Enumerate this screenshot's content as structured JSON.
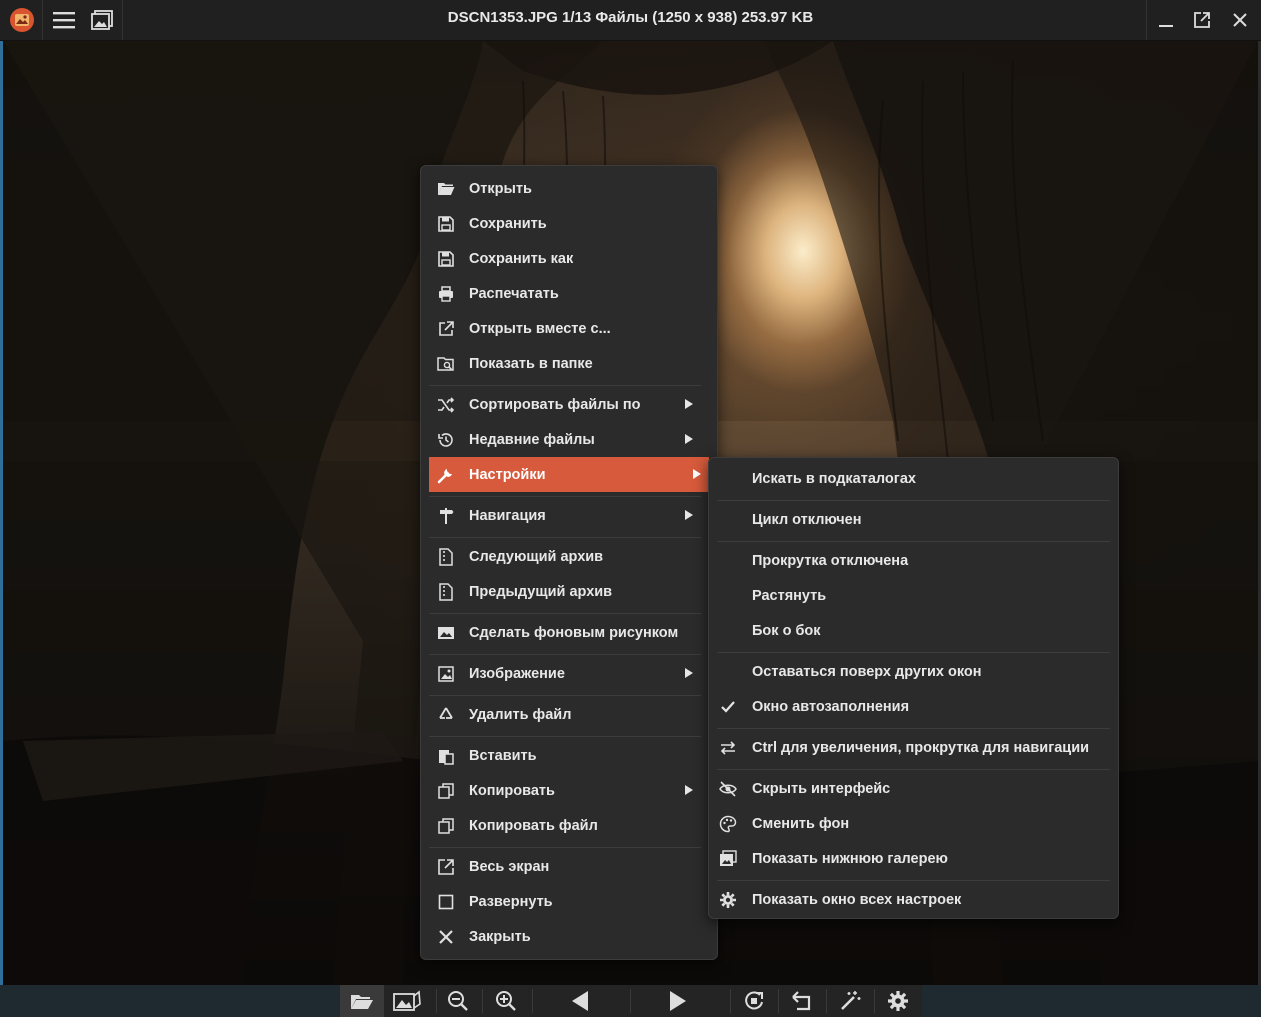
{
  "window": {
    "title": "DSCN1353.JPG 1/13 Файлы (1250 x 938) 253.97 KB"
  },
  "context_menu": {
    "items": [
      {
        "label": "Открыть",
        "icon": "folder-open-icon"
      },
      {
        "label": "Сохранить",
        "icon": "floppy-icon"
      },
      {
        "label": "Сохранить как",
        "icon": "floppy-icon"
      },
      {
        "label": "Распечатать",
        "icon": "printer-icon"
      },
      {
        "label": "Открыть вместе с...",
        "icon": "external-link-icon"
      },
      {
        "label": "Показать в папке",
        "icon": "folder-search-icon"
      },
      {
        "label": "Сортировать файлы по",
        "icon": "shuffle-icon",
        "submenu": true
      },
      {
        "label": "Недавние файлы",
        "icon": "history-icon",
        "submenu": true
      },
      {
        "label": "Настройки",
        "icon": "wrench-icon",
        "submenu": true,
        "highlighted": true
      },
      {
        "label": "Навигация",
        "icon": "signpost-icon",
        "submenu": true
      },
      {
        "label": "Следующий архив",
        "icon": "archive-next-icon"
      },
      {
        "label": "Предыдущий архив",
        "icon": "archive-prev-icon"
      },
      {
        "label": "Сделать фоновым рисунком",
        "icon": "wallpaper-icon"
      },
      {
        "label": "Изображение",
        "icon": "image-icon",
        "submenu": true
      },
      {
        "label": "Удалить файл",
        "icon": "recycle-icon"
      },
      {
        "label": "Вставить",
        "icon": "paste-icon"
      },
      {
        "label": "Копировать",
        "icon": "copy-icon",
        "submenu": true
      },
      {
        "label": "Копировать файл",
        "icon": "copy-icon"
      },
      {
        "label": "Весь экран",
        "icon": "fullscreen-icon"
      },
      {
        "label": "Развернуть",
        "icon": "maximize-icon"
      },
      {
        "label": "Закрыть",
        "icon": "close-icon"
      }
    ]
  },
  "settings_submenu": {
    "items": [
      {
        "label": "Искать в подкаталогах"
      },
      {
        "label": "Цикл отключен"
      },
      {
        "label": "Прокрутка отключена"
      },
      {
        "label": "Растянуть"
      },
      {
        "label": "Бок о бок"
      },
      {
        "label": "Оставаться поверх других окон"
      },
      {
        "label": "Окно автозаполнения",
        "checked": true,
        "icon": "checkmark-icon"
      },
      {
        "label": "Ctrl для увеличения, прокрутка для навигации",
        "icon": "swap-arrows-icon"
      },
      {
        "label": "Скрыть интерфейс",
        "icon": "eye-off-icon"
      },
      {
        "label": "Сменить фон",
        "icon": "palette-icon"
      },
      {
        "label": "Показать нижнюю галерею",
        "icon": "gallery-icon"
      },
      {
        "label": "Показать окно всех настроек",
        "icon": "gear-icon"
      }
    ]
  },
  "colors": {
    "highlight": "#d65a3b",
    "menu_bg": "#2b2b2b",
    "titlebar_bg": "#202020"
  }
}
